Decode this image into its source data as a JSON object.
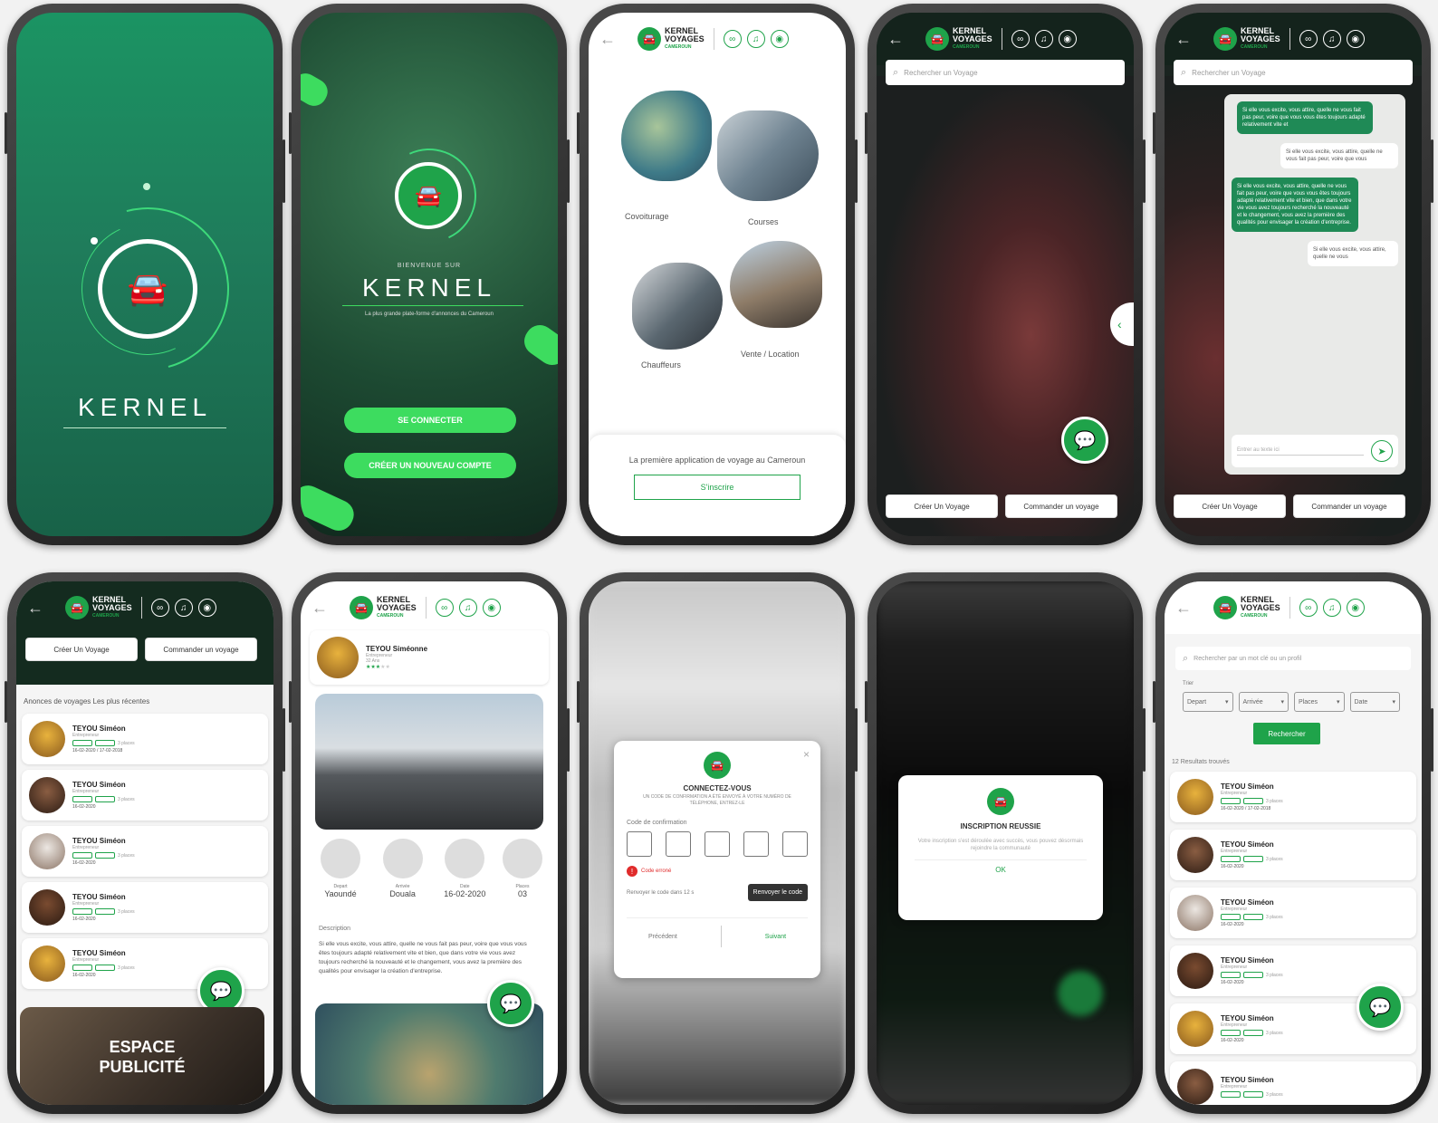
{
  "brand": {
    "name": "KERNEL",
    "badge_l1": "KERNEL",
    "badge_l2": "VOYAGES",
    "badge_l3": "CAMEROUN",
    "green": "#1fa34a",
    "accent": "#3ddc5f"
  },
  "s1": {
    "title": "KERNEL"
  },
  "s2": {
    "welcome": "BIENVENUE SUR",
    "title": "KERNEL",
    "tagline": "La plus grande plate-forme d'annonces du Cameroun",
    "login": "SE CONNECTER",
    "register": "CRÉER UN NOUVEAU COMPTE"
  },
  "s3": {
    "cat1": "Covoiturage",
    "cat2": "Courses",
    "cat3": "Chauffeurs",
    "cat4": "Vente / Location",
    "tagline": "La première application de voyage au Cameroun",
    "cta": "S'inscrire"
  },
  "s4": {
    "search_placeholder": "Rechercher un Voyage",
    "create": "Créer Un Voyage",
    "order": "Commander un voyage"
  },
  "s5": {
    "search_placeholder": "Rechercher un Voyage",
    "messages": [
      {
        "who": "in",
        "text": "Si elle vous excite, vous attire, quelle ne vous fait pas peur, voire que vous vous êtes toujours adapté relativement vite et"
      },
      {
        "who": "out",
        "text": "Si elle vous excite, vous attire, quelle ne vous fait pas peur, voire que vous"
      },
      {
        "who": "in",
        "text": "Si elle vous excite, vous attire, quelle ne vous fait pas peur, voire que vous vous êtes toujours adapté relativement vite et bien, que dans votre vie vous avez toujours recherché la nouveauté et le changement, vous avez la première des qualités pour envisager la création d'entreprise."
      },
      {
        "who": "out",
        "text": "Si elle vous excite, vous attire, quelle ne vous"
      }
    ],
    "input_placeholder": "Entrer au texte ici",
    "create": "Créer Un Voyage",
    "order": "Commander un voyage"
  },
  "s6": {
    "create": "Créer Un Voyage",
    "order": "Commander un voyage",
    "section": "Anonces de voyages Les plus récentes",
    "rows": [
      {
        "name": "TEYOU Siméon",
        "role": "Entrepreneur",
        "places": "3 places",
        "date": "16-02-2020 / 17-02-2018"
      },
      {
        "name": "TEYOU Siméon",
        "role": "Entrepreneur",
        "places": "3 places",
        "date": "16-02-2020"
      },
      {
        "name": "TEYOU Siméon",
        "role": "Entrepreneur",
        "places": "3 places",
        "date": "16-02-2020"
      },
      {
        "name": "TEYOU Siméon",
        "role": "Entrepreneur",
        "places": "3 places",
        "date": "16-02-2020"
      },
      {
        "name": "TEYOU Siméon",
        "role": "Entrepreneur",
        "places": "3 places",
        "date": "16-02-2020"
      }
    ],
    "ad": "ESPACE PUBLICITÉ"
  },
  "s7": {
    "name": "TEYOU Siméonne",
    "role": "Entrepreneur",
    "age": "32 Ans",
    "depart_label": "Depart",
    "depart": "Yaoundé",
    "arrivee_label": "Arrivée",
    "arrivee": "Douala",
    "date_label": "Date",
    "date": "16-02-2020",
    "places_label": "Places",
    "places": "03",
    "desc_label": "Description",
    "desc": "Si elle vous excite, vous attire, quelle ne vous fait pas peur, voire que vous vous êtes toujours adapté relativement vite et bien, que dans votre vie vous avez toujours recherché la nouveauté et le changement, vous avez la première des qualités pour envisager la création d'entreprise."
  },
  "s8": {
    "title": "CONNECTEZ-VOUS",
    "subtitle": "UN CODE DE CONFIRMATION A ÉTÉ ENVOYÉ À VOTRE NUMÉRO DE TÉLÉPHONE, ENTREZ-LE",
    "code_label": "Code de confirmation",
    "error": "Code erroné",
    "resend_timer": "Renvoyer le code dans 12 s",
    "resend": "Renvoyer le code",
    "prev": "Précédent",
    "next": "Suivant"
  },
  "s9": {
    "title": "INSCRIPTION REUSSIE",
    "body": "Votre inscription s'est déroulée avec succès, vous pouvez désormais rejoindre la communauté",
    "ok": "OK"
  },
  "s10": {
    "search_placeholder": "Rechercher par un mot clé ou un profil",
    "filter_label": "Trier",
    "f1": "Depart",
    "f2": "Arrivée",
    "f3": "Places",
    "f4": "Date",
    "search_btn": "Rechercher",
    "results": "12 Resultats trouvés",
    "rows": [
      {
        "name": "TEYOU Siméon",
        "role": "Entrepreneur",
        "places": "3 places",
        "date": "16-02-2020 / 17-02-2018"
      },
      {
        "name": "TEYOU Siméon",
        "role": "Entrepreneur",
        "places": "3 places",
        "date": "16-02-2020"
      },
      {
        "name": "TEYOU Siméon",
        "role": "Entrepreneur",
        "places": "3 places",
        "date": "16-02-2020"
      },
      {
        "name": "TEYOU Siméon",
        "role": "Entrepreneur",
        "places": "3 places",
        "date": "16-02-2020"
      },
      {
        "name": "TEYOU Siméon",
        "role": "Entrepreneur",
        "places": "3 places",
        "date": "16-02-2020"
      },
      {
        "name": "TEYOU Siméon",
        "role": "Entrepreneur",
        "places": "3 places",
        "date": ""
      }
    ]
  }
}
